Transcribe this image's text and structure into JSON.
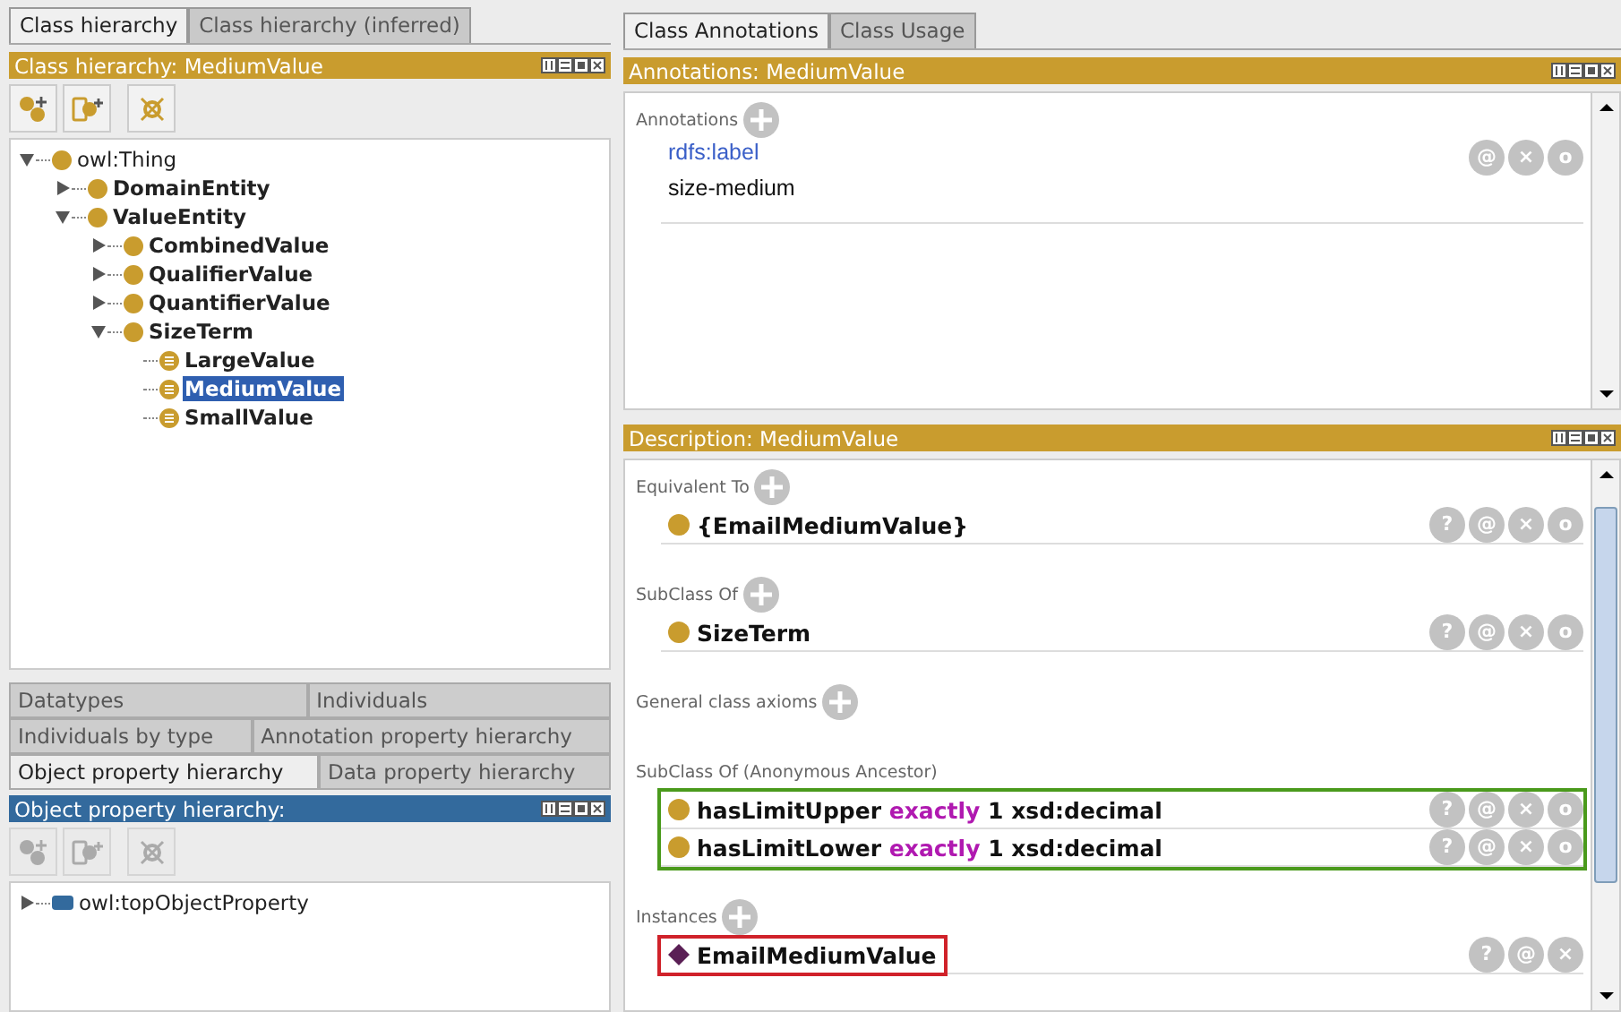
{
  "left": {
    "tabs": [
      {
        "label": "Class hierarchy",
        "selected": true
      },
      {
        "label": "Class hierarchy (inferred)",
        "selected": false
      }
    ],
    "class_view": {
      "title": "Class hierarchy: MediumValue",
      "toolbar_disabled": false,
      "tree": [
        {
          "label": "owl:Thing",
          "kind": "class",
          "expanded": true,
          "bold": false,
          "selected": false,
          "children": [
            {
              "label": "DomainEntity",
              "kind": "class",
              "expanded": false,
              "bold": true,
              "selected": false
            },
            {
              "label": "ValueEntity",
              "kind": "class",
              "expanded": true,
              "bold": true,
              "selected": false,
              "children": [
                {
                  "label": "CombinedValue",
                  "kind": "class",
                  "expanded": false,
                  "bold": true,
                  "selected": false
                },
                {
                  "label": "QualifierValue",
                  "kind": "class",
                  "expanded": false,
                  "bold": true,
                  "selected": false
                },
                {
                  "label": "QuantifierValue",
                  "kind": "class",
                  "expanded": false,
                  "bold": true,
                  "selected": false
                },
                {
                  "label": "SizeTerm",
                  "kind": "class",
                  "expanded": true,
                  "bold": true,
                  "selected": false,
                  "children": [
                    {
                      "label": "LargeValue",
                      "kind": "defined",
                      "bold": true,
                      "selected": false
                    },
                    {
                      "label": "MediumValue",
                      "kind": "defined",
                      "bold": true,
                      "selected": true
                    },
                    {
                      "label": "SmallValue",
                      "kind": "defined",
                      "bold": true,
                      "selected": false
                    }
                  ]
                }
              ]
            }
          ]
        }
      ]
    },
    "lower_tab_rows": [
      {
        "tabs": [
          {
            "label": "Datatypes",
            "selected": false
          },
          {
            "label": "Individuals",
            "selected": false
          }
        ]
      },
      {
        "tabs": [
          {
            "label": "Individuals by type",
            "selected": false
          },
          {
            "label": "Annotation property hierarchy",
            "selected": false
          }
        ]
      },
      {
        "tabs": [
          {
            "label": "Object property hierarchy",
            "selected": true
          },
          {
            "label": "Data property hierarchy",
            "selected": false
          }
        ]
      }
    ],
    "property_view": {
      "title": "Object property hierarchy:",
      "toolbar_disabled": true,
      "tree": [
        {
          "label": "owl:topObjectProperty",
          "kind": "property",
          "expanded": false,
          "bold": false,
          "selected": false
        }
      ]
    }
  },
  "right": {
    "tabs": [
      {
        "label": "Class Annotations",
        "selected": true
      },
      {
        "label": "Class Usage",
        "selected": false
      }
    ],
    "annotations": {
      "title": "Annotations: MediumValue",
      "section": "Annotations",
      "items": [
        {
          "property": "rdfs:label",
          "value": "size-medium",
          "actions": [
            "@",
            "×",
            "o"
          ]
        }
      ]
    },
    "description": {
      "title": "Description: MediumValue",
      "sections": [
        {
          "title": "Equivalent To",
          "addable": true,
          "items": [
            {
              "kind": "class",
              "parts": [
                {
                  "text": "{EmailMediumValue}",
                  "kind": "name"
                }
              ],
              "actions": [
                "?",
                "@",
                "×",
                "o"
              ]
            }
          ]
        },
        {
          "title": "SubClass Of",
          "addable": true,
          "items": [
            {
              "kind": "class",
              "parts": [
                {
                  "text": "SizeTerm",
                  "kind": "name"
                }
              ],
              "actions": [
                "?",
                "@",
                "×",
                "o"
              ]
            }
          ]
        },
        {
          "title": "General class axioms",
          "addable": true
        },
        {
          "title": "SubClass Of (Anonymous Ancestor)",
          "addable": false,
          "color": "#4a9a1c",
          "items": [
            {
              "kind": "class",
              "parts": [
                {
                  "text": "hasLimitUpper",
                  "kind": "name"
                },
                {
                  "text": "exactly",
                  "kind": "keyword"
                },
                {
                  "text": "1 xsd:decimal",
                  "kind": "name"
                }
              ],
              "actions": [
                "?",
                "@",
                "×",
                "o"
              ]
            },
            {
              "kind": "class",
              "parts": [
                {
                  "text": "hasLimitLower",
                  "kind": "name"
                },
                {
                  "text": "exactly",
                  "kind": "keyword"
                },
                {
                  "text": "1 xsd:decimal",
                  "kind": "name"
                }
              ],
              "actions": [
                "?",
                "@",
                "×",
                "o"
              ]
            }
          ]
        },
        {
          "title": "Instances",
          "addable": true,
          "color": "#d0222a",
          "items": [
            {
              "kind": "individual",
              "parts": [
                {
                  "text": "EmailMediumValue",
                  "kind": "name"
                }
              ],
              "actions": [
                "?",
                "@",
                "×"
              ]
            }
          ]
        }
      ]
    }
  }
}
